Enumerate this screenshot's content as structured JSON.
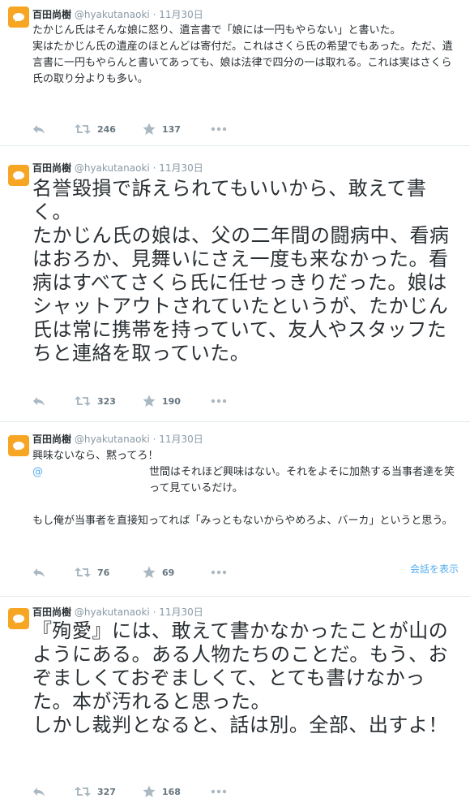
{
  "colors": {
    "accent": "#55acee",
    "avatar": "#f6a623",
    "meta": "#8899a6"
  },
  "tweets": [
    {
      "name": "百田尚樹",
      "handle": "@hyakutanaoki",
      "dot": "·",
      "time": "11月30日",
      "text": "たかじん氏はそんな娘に怒り、遺言書で「娘には一円もやらない」と書いた。\n実はたかじん氏の遺産のほとんどは寄付だ。これはさくら氏の希望でもあった。ただ、遺言書に一円もやらんと書いてあっても、娘は法律で四分の一は取れる。これは実はさくら氏の取り分よりも多い。",
      "retweets": "246",
      "favorites": "137"
    },
    {
      "name": "百田尚樹",
      "handle": "@hyakutanaoki",
      "dot": "·",
      "time": "11月30日",
      "text": "名誉毀損で訴えられてもいいから、敢えて書く。\nたかじん氏の娘は、父の二年間の闘病中、看病はおろか、見舞いにさえ一度も来なかった。看病はすべてさくら氏に任せっきりだった。娘はシャットアウトされていたというが、たかじん氏は常に携帯を持っていて、友人やスタッフたちと連絡を取っていた。",
      "retweets": "323",
      "favorites": "190"
    },
    {
      "name": "百田尚樹",
      "handle": "@hyakutanaoki",
      "dot": "·",
      "time": "11月30日",
      "text_line1": "興味ないなら、黙ってろ！",
      "mention": "@",
      "text_line2": "世間はそれほど興味はない。それをよそに加熱する当事者達を笑って見ているだけ。",
      "text_rest": "もし俺が当事者を直接知ってれば「みっともないからやめろよ、バーカ」というと思う。",
      "retweets": "76",
      "favorites": "69",
      "conversation": "会話を表示"
    },
    {
      "name": "百田尚樹",
      "handle": "@hyakutanaoki",
      "dot": "·",
      "time": "11月30日",
      "text": "『殉愛』には、敢えて書かなかったことが山のようにある。ある人物たちのことだ。もう、おぞましくておぞましくて、とても書けなかった。本が汚れると思った。\nしかし裁判となると、話は別。全部、出すよ！",
      "retweets": "327",
      "favorites": "168"
    }
  ]
}
